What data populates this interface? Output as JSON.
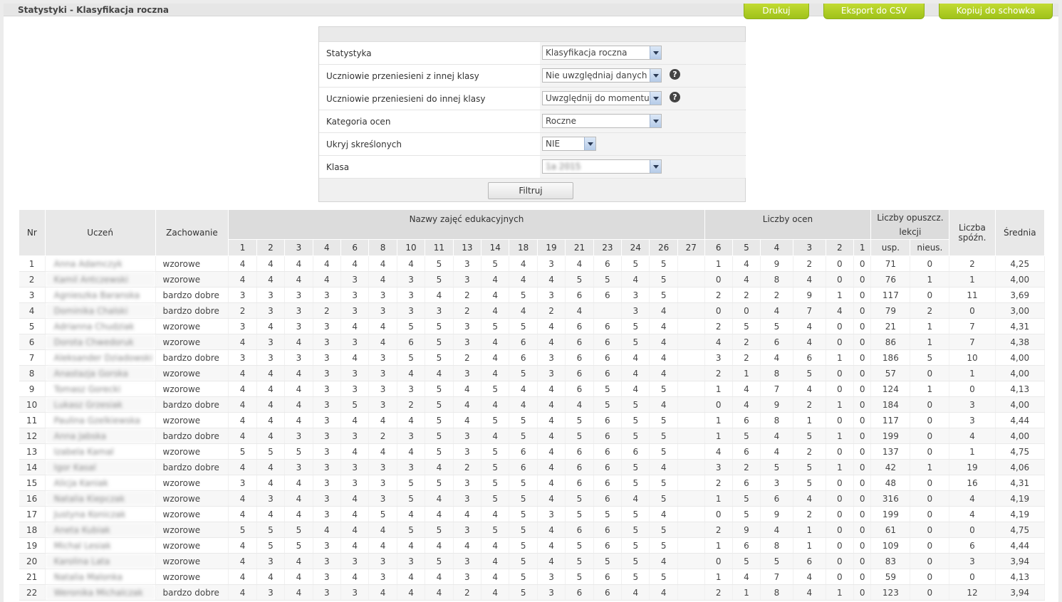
{
  "page": {
    "title": "Statystyki - Klasyfikacja roczna"
  },
  "top_buttons": {
    "print": "Drukuj",
    "csv": "Eksport do CSV",
    "copy": "Kopiuj do schowka"
  },
  "filter": {
    "rows": [
      {
        "label": "Statystyka",
        "value": "Klasyfikacja roczna",
        "help": false
      },
      {
        "label": "Uczniowie przeniesieni z innej klasy",
        "value": "Nie uwzględniaj danych z",
        "help": true
      },
      {
        "label": "Uczniowie przeniesieni do innej klasy",
        "value": "Uwzględnij do momentu p",
        "help": true
      },
      {
        "label": "Kategoria ocen",
        "value": "Roczne",
        "help": false
      },
      {
        "label": "Ukryj skreślonych",
        "value": "NIE",
        "help": false
      },
      {
        "label": "Klasa",
        "value": "1a 2015",
        "help": false
      }
    ],
    "button": "Filtruj"
  },
  "table": {
    "headers": {
      "nr": "Nr",
      "student": "Uczeń",
      "behavior": "Zachowanie",
      "subjects_group": "Nazwy zajęć edukacyjnych",
      "grades_group": "Liczby ocen",
      "absence_group": "Liczby opuszcz. lekcji",
      "late": "Liczba spóźn.",
      "avg": "Średnia"
    },
    "subject_cols": [
      "1",
      "2",
      "3",
      "4",
      "6",
      "8",
      "10",
      "11",
      "13",
      "14",
      "18",
      "19",
      "21",
      "23",
      "24",
      "26",
      "27"
    ],
    "grade_cols": [
      "6",
      "5",
      "4",
      "3",
      "2",
      "1"
    ],
    "absence_cols": [
      "usp.",
      "nieus."
    ],
    "rows": [
      {
        "nr": "1",
        "name": "Anna Adamczyk",
        "beh": "wzorowe",
        "s": [
          "4",
          "4",
          "4",
          "4",
          "4",
          "4",
          "4",
          "5",
          "3",
          "5",
          "4",
          "3",
          "4",
          "6",
          "5",
          "5",
          ""
        ],
        "g": [
          "1",
          "4",
          "9",
          "2",
          "0",
          "0"
        ],
        "a": [
          "71",
          "0"
        ],
        "late": "2",
        "avg": "4,25"
      },
      {
        "nr": "2",
        "name": "Kamil Antczewski",
        "beh": "wzorowe",
        "s": [
          "4",
          "4",
          "4",
          "4",
          "3",
          "4",
          "3",
          "5",
          "3",
          "4",
          "4",
          "4",
          "5",
          "5",
          "4",
          "5",
          ""
        ],
        "g": [
          "0",
          "4",
          "8",
          "4",
          "0",
          "0"
        ],
        "a": [
          "76",
          "1"
        ],
        "late": "1",
        "avg": "4,00"
      },
      {
        "nr": "3",
        "name": "Agnieszka Baranska",
        "beh": "bardzo dobre",
        "s": [
          "3",
          "3",
          "3",
          "3",
          "3",
          "3",
          "3",
          "4",
          "2",
          "4",
          "5",
          "3",
          "6",
          "6",
          "3",
          "5",
          ""
        ],
        "g": [
          "2",
          "2",
          "2",
          "9",
          "1",
          "0"
        ],
        "a": [
          "117",
          "0"
        ],
        "late": "11",
        "avg": "3,69"
      },
      {
        "nr": "4",
        "name": "Dominika Chalski",
        "beh": "bardzo dobre",
        "s": [
          "2",
          "3",
          "3",
          "2",
          "3",
          "3",
          "3",
          "3",
          "2",
          "4",
          "4",
          "2",
          "4",
          "",
          "3",
          "4",
          ""
        ],
        "g": [
          "0",
          "0",
          "4",
          "7",
          "4",
          "0"
        ],
        "a": [
          "79",
          "2"
        ],
        "late": "0",
        "avg": "3,00"
      },
      {
        "nr": "5",
        "name": "Adrianna Chudziak",
        "beh": "wzorowe",
        "s": [
          "3",
          "4",
          "3",
          "3",
          "4",
          "4",
          "5",
          "5",
          "3",
          "5",
          "5",
          "4",
          "6",
          "6",
          "5",
          "4",
          ""
        ],
        "g": [
          "2",
          "5",
          "5",
          "4",
          "0",
          "0"
        ],
        "a": [
          "21",
          "1"
        ],
        "late": "7",
        "avg": "4,31"
      },
      {
        "nr": "6",
        "name": "Dorota Chwedoruk",
        "beh": "wzorowe",
        "s": [
          "4",
          "3",
          "4",
          "3",
          "3",
          "4",
          "6",
          "5",
          "3",
          "4",
          "6",
          "4",
          "6",
          "6",
          "5",
          "4",
          ""
        ],
        "g": [
          "4",
          "2",
          "6",
          "4",
          "0",
          "0"
        ],
        "a": [
          "86",
          "1"
        ],
        "late": "7",
        "avg": "4,38"
      },
      {
        "nr": "7",
        "name": "Aleksander Dziadowski",
        "beh": "bardzo dobre",
        "s": [
          "3",
          "3",
          "3",
          "3",
          "4",
          "3",
          "5",
          "5",
          "2",
          "4",
          "6",
          "3",
          "6",
          "6",
          "4",
          "4",
          ""
        ],
        "g": [
          "3",
          "2",
          "4",
          "6",
          "1",
          "0"
        ],
        "a": [
          "186",
          "5"
        ],
        "late": "10",
        "avg": "4,00"
      },
      {
        "nr": "8",
        "name": "Anastazja Gorska",
        "beh": "wzorowe",
        "s": [
          "4",
          "4",
          "4",
          "3",
          "3",
          "3",
          "4",
          "4",
          "3",
          "4",
          "5",
          "3",
          "6",
          "6",
          "4",
          "4",
          ""
        ],
        "g": [
          "2",
          "1",
          "8",
          "5",
          "0",
          "0"
        ],
        "a": [
          "57",
          "0"
        ],
        "late": "1",
        "avg": "4,00"
      },
      {
        "nr": "9",
        "name": "Tomasz Gorecki",
        "beh": "wzorowe",
        "s": [
          "4",
          "4",
          "4",
          "3",
          "3",
          "3",
          "3",
          "5",
          "4",
          "5",
          "4",
          "4",
          "6",
          "5",
          "4",
          "5",
          ""
        ],
        "g": [
          "1",
          "4",
          "7",
          "4",
          "0",
          "0"
        ],
        "a": [
          "124",
          "1"
        ],
        "late": "0",
        "avg": "4,13"
      },
      {
        "nr": "10",
        "name": "Lukasz Grzesiak",
        "beh": "bardzo dobre",
        "s": [
          "4",
          "4",
          "4",
          "3",
          "5",
          "3",
          "2",
          "5",
          "4",
          "4",
          "4",
          "4",
          "4",
          "5",
          "5",
          "4",
          ""
        ],
        "g": [
          "0",
          "4",
          "9",
          "2",
          "1",
          "0"
        ],
        "a": [
          "184",
          "0"
        ],
        "late": "3",
        "avg": "4,00"
      },
      {
        "nr": "11",
        "name": "Paulina Gzelkiewska",
        "beh": "wzorowe",
        "s": [
          "4",
          "4",
          "4",
          "3",
          "4",
          "4",
          "4",
          "5",
          "4",
          "5",
          "5",
          "4",
          "5",
          "6",
          "5",
          "5",
          ""
        ],
        "g": [
          "1",
          "6",
          "8",
          "1",
          "0",
          "0"
        ],
        "a": [
          "117",
          "0"
        ],
        "late": "3",
        "avg": "4,44"
      },
      {
        "nr": "12",
        "name": "Anna Jabska",
        "beh": "bardzo dobre",
        "s": [
          "4",
          "4",
          "3",
          "3",
          "3",
          "2",
          "3",
          "5",
          "3",
          "4",
          "5",
          "4",
          "5",
          "6",
          "5",
          "5",
          ""
        ],
        "g": [
          "1",
          "5",
          "4",
          "5",
          "1",
          "0"
        ],
        "a": [
          "199",
          "0"
        ],
        "late": "4",
        "avg": "4,00"
      },
      {
        "nr": "13",
        "name": "Izabela Kamal",
        "beh": "wzorowe",
        "s": [
          "5",
          "5",
          "5",
          "3",
          "4",
          "4",
          "4",
          "5",
          "3",
          "5",
          "6",
          "4",
          "6",
          "6",
          "6",
          "5",
          ""
        ],
        "g": [
          "4",
          "6",
          "4",
          "2",
          "0",
          "0"
        ],
        "a": [
          "137",
          "0"
        ],
        "late": "1",
        "avg": "4,75"
      },
      {
        "nr": "14",
        "name": "Igor Kasal",
        "beh": "bardzo dobre",
        "s": [
          "4",
          "4",
          "3",
          "3",
          "3",
          "3",
          "3",
          "4",
          "2",
          "5",
          "6",
          "4",
          "6",
          "6",
          "5",
          "4",
          ""
        ],
        "g": [
          "3",
          "2",
          "5",
          "5",
          "1",
          "0"
        ],
        "a": [
          "42",
          "1"
        ],
        "late": "19",
        "avg": "4,06"
      },
      {
        "nr": "15",
        "name": "Alicja Kaniak",
        "beh": "wzorowe",
        "s": [
          "3",
          "4",
          "4",
          "3",
          "3",
          "3",
          "5",
          "5",
          "3",
          "5",
          "5",
          "4",
          "6",
          "6",
          "5",
          "5",
          ""
        ],
        "g": [
          "2",
          "6",
          "3",
          "5",
          "0",
          "0"
        ],
        "a": [
          "48",
          "0"
        ],
        "late": "16",
        "avg": "4,31"
      },
      {
        "nr": "16",
        "name": "Natalia Kiepczak",
        "beh": "wzorowe",
        "s": [
          "4",
          "3",
          "4",
          "3",
          "4",
          "3",
          "5",
          "4",
          "3",
          "5",
          "5",
          "4",
          "5",
          "6",
          "4",
          "5",
          ""
        ],
        "g": [
          "1",
          "5",
          "6",
          "4",
          "0",
          "0"
        ],
        "a": [
          "316",
          "0"
        ],
        "late": "4",
        "avg": "4,19"
      },
      {
        "nr": "17",
        "name": "Justyna Koniczak",
        "beh": "wzorowe",
        "s": [
          "4",
          "4",
          "4",
          "3",
          "4",
          "5",
          "4",
          "4",
          "4",
          "4",
          "5",
          "3",
          "5",
          "5",
          "5",
          "4",
          ""
        ],
        "g": [
          "0",
          "5",
          "9",
          "2",
          "0",
          "0"
        ],
        "a": [
          "199",
          "0"
        ],
        "late": "4",
        "avg": "4,19"
      },
      {
        "nr": "18",
        "name": "Aneta Kubiak",
        "beh": "wzorowe",
        "s": [
          "5",
          "5",
          "5",
          "4",
          "4",
          "4",
          "5",
          "5",
          "3",
          "5",
          "5",
          "4",
          "6",
          "6",
          "5",
          "5",
          ""
        ],
        "g": [
          "2",
          "9",
          "4",
          "1",
          "0",
          "0"
        ],
        "a": [
          "61",
          "0"
        ],
        "late": "0",
        "avg": "4,75"
      },
      {
        "nr": "19",
        "name": "Michal Lesiak",
        "beh": "wzorowe",
        "s": [
          "4",
          "5",
          "5",
          "3",
          "4",
          "4",
          "4",
          "4",
          "4",
          "4",
          "5",
          "4",
          "5",
          "6",
          "5",
          "5",
          ""
        ],
        "g": [
          "1",
          "6",
          "8",
          "1",
          "0",
          "0"
        ],
        "a": [
          "109",
          "0"
        ],
        "late": "6",
        "avg": "4,44"
      },
      {
        "nr": "20",
        "name": "Karolina Lata",
        "beh": "wzorowe",
        "s": [
          "4",
          "3",
          "4",
          "3",
          "3",
          "3",
          "3",
          "5",
          "3",
          "4",
          "5",
          "4",
          "5",
          "5",
          "5",
          "4",
          ""
        ],
        "g": [
          "0",
          "5",
          "5",
          "6",
          "0",
          "0"
        ],
        "a": [
          "83",
          "0"
        ],
        "late": "3",
        "avg": "3,94"
      },
      {
        "nr": "21",
        "name": "Natalia Malonka",
        "beh": "wzorowe",
        "s": [
          "4",
          "4",
          "4",
          "3",
          "4",
          "3",
          "4",
          "4",
          "3",
          "4",
          "5",
          "3",
          "5",
          "6",
          "5",
          "5",
          ""
        ],
        "g": [
          "1",
          "4",
          "7",
          "4",
          "0",
          "0"
        ],
        "a": [
          "59",
          "0"
        ],
        "late": "0",
        "avg": "4,13"
      },
      {
        "nr": "22",
        "name": "Weronika Michalczak",
        "beh": "bardzo dobre",
        "s": [
          "4",
          "3",
          "4",
          "3",
          "3",
          "4",
          "4",
          "4",
          "2",
          "4",
          "5",
          "3",
          "6",
          "6",
          "4",
          "4",
          ""
        ],
        "g": [
          "2",
          "1",
          "8",
          "4",
          "1",
          "0"
        ],
        "a": [
          "123",
          "0"
        ],
        "late": "12",
        "avg": "3,94"
      }
    ]
  }
}
